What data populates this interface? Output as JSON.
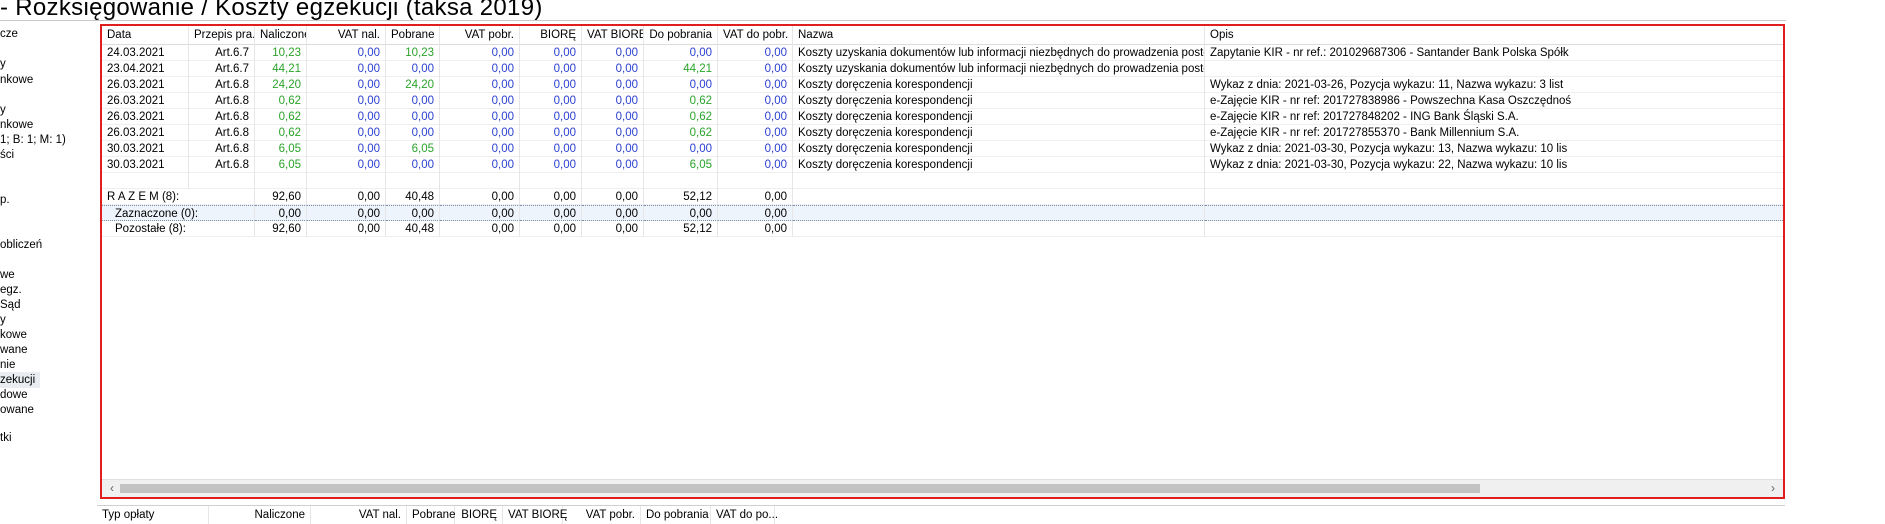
{
  "window": {
    "title": "- Rozksięgowanie / Koszty egzekucji (taksa 2019)"
  },
  "left_nav": {
    "items": [
      {
        "label": "cze"
      },
      {
        "label": ""
      },
      {
        "label": "y"
      },
      {
        "label": "nkowe"
      },
      {
        "label": ""
      },
      {
        "label": "y"
      },
      {
        "label": "nkowe"
      },
      {
        "label": "1; B: 1; M: 1)"
      },
      {
        "label": "ści"
      },
      {
        "label": ""
      },
      {
        "label": ""
      },
      {
        "label": "p."
      },
      {
        "label": ""
      },
      {
        "label": ""
      },
      {
        "label": "obliczeń"
      },
      {
        "label": ""
      },
      {
        "label": "we"
      },
      {
        "label": "egz."
      },
      {
        "label": "Sąd"
      },
      {
        "label": "y"
      },
      {
        "label": "kowe"
      },
      {
        "label": "wane"
      },
      {
        "label": "nie"
      },
      {
        "label": "zekucji"
      },
      {
        "label": "dowe"
      },
      {
        "label": "owane"
      },
      {
        "label": ""
      },
      {
        "label": "tki"
      }
    ]
  },
  "table": {
    "columns": [
      "Data",
      "Przepis pra...",
      "Naliczone",
      "VAT nal.",
      "Pobrane",
      "VAT pobr.",
      "BIORĘ",
      "VAT BIORĘ",
      "Do pobrania",
      "VAT do pobr.",
      "Nazwa",
      "Opis"
    ],
    "rows": [
      {
        "data": "24.03.2021",
        "przepis": "Art.6.7",
        "naliczone": "10,23",
        "vat_nal": "0,00",
        "pobrane": "10,23",
        "vat_pobr": "0,00",
        "biore": "0,00",
        "vat_biore": "0,00",
        "do_pobrania": "0,00",
        "vat_do_pobr": "0,00",
        "nazwa": "Koszty uzyskania dokumentów lub informacji niezbędnych do prowadzenia postępowania",
        "opis": "Zapytanie KIR - nr ref.: 201029687306 - Santander Bank Polska Spółk"
      },
      {
        "data": "23.04.2021",
        "przepis": "Art.6.7",
        "naliczone": "44,21",
        "vat_nal": "0,00",
        "pobrane": "0,00",
        "vat_pobr": "0,00",
        "biore": "0,00",
        "vat_biore": "0,00",
        "do_pobrania": "44,21",
        "vat_do_pobr": "0,00",
        "nazwa": "Koszty uzyskania dokumentów lub informacji niezbędnych do prowadzenia postępowania",
        "opis": ""
      },
      {
        "data": "26.03.2021",
        "przepis": "Art.6.8",
        "naliczone": "24,20",
        "vat_nal": "0,00",
        "pobrane": "24,20",
        "vat_pobr": "0,00",
        "biore": "0,00",
        "vat_biore": "0,00",
        "do_pobrania": "0,00",
        "vat_do_pobr": "0,00",
        "nazwa": "Koszty doręczenia korespondencji",
        "opis": "Wykaz z dnia: 2021-03-26, Pozycja wykazu: 11, Nazwa wykazu: 3 list"
      },
      {
        "data": "26.03.2021",
        "przepis": "Art.6.8",
        "naliczone": "0,62",
        "vat_nal": "0,00",
        "pobrane": "0,00",
        "vat_pobr": "0,00",
        "biore": "0,00",
        "vat_biore": "0,00",
        "do_pobrania": "0,62",
        "vat_do_pobr": "0,00",
        "nazwa": "Koszty doręczenia korespondencji",
        "opis": "e-Zajęcie KIR - nr ref: 201727838986 - Powszechna Kasa Oszczędnoś"
      },
      {
        "data": "26.03.2021",
        "przepis": "Art.6.8",
        "naliczone": "0,62",
        "vat_nal": "0,00",
        "pobrane": "0,00",
        "vat_pobr": "0,00",
        "biore": "0,00",
        "vat_biore": "0,00",
        "do_pobrania": "0,62",
        "vat_do_pobr": "0,00",
        "nazwa": "Koszty doręczenia korespondencji",
        "opis": "e-Zajęcie KIR - nr ref: 201727848202 - ING Bank Śląski S.A."
      },
      {
        "data": "26.03.2021",
        "przepis": "Art.6.8",
        "naliczone": "0,62",
        "vat_nal": "0,00",
        "pobrane": "0,00",
        "vat_pobr": "0,00",
        "biore": "0,00",
        "vat_biore": "0,00",
        "do_pobrania": "0,62",
        "vat_do_pobr": "0,00",
        "nazwa": "Koszty doręczenia korespondencji",
        "opis": "e-Zajęcie KIR - nr ref: 201727855370 - Bank Millennium S.A."
      },
      {
        "data": "30.03.2021",
        "przepis": "Art.6.8",
        "naliczone": "6,05",
        "vat_nal": "0,00",
        "pobrane": "6,05",
        "vat_pobr": "0,00",
        "biore": "0,00",
        "vat_biore": "0,00",
        "do_pobrania": "0,00",
        "vat_do_pobr": "0,00",
        "nazwa": "Koszty doręczenia korespondencji",
        "opis": "Wykaz z dnia: 2021-03-30, Pozycja wykazu: 13, Nazwa wykazu: 10 lis"
      },
      {
        "data": "30.03.2021",
        "przepis": "Art.6.8",
        "naliczone": "6,05",
        "vat_nal": "0,00",
        "pobrane": "0,00",
        "vat_pobr": "0,00",
        "biore": "0,00",
        "vat_biore": "0,00",
        "do_pobrania": "6,05",
        "vat_do_pobr": "0,00",
        "nazwa": "Koszty doręczenia korespondencji",
        "opis": "Wykaz z dnia: 2021-03-30, Pozycja wykazu: 22, Nazwa wykazu: 10 lis"
      }
    ],
    "summary": [
      {
        "label": "R A Z E M (8):",
        "naliczone": "92,60",
        "vat_nal": "0,00",
        "pobrane": "40,48",
        "vat_pobr": "0,00",
        "biore": "0,00",
        "vat_biore": "0,00",
        "do_pobrania": "52,12",
        "vat_do_pobr": "0,00"
      },
      {
        "label": "Zaznaczone (0):",
        "naliczone": "0,00",
        "vat_nal": "0,00",
        "pobrane": "0,00",
        "vat_pobr": "0,00",
        "biore": "0,00",
        "vat_biore": "0,00",
        "do_pobrania": "0,00",
        "vat_do_pobr": "0,00"
      },
      {
        "label": "Pozostałe (8):",
        "naliczone": "92,60",
        "vat_nal": "0,00",
        "pobrane": "40,48",
        "vat_pobr": "0,00",
        "biore": "0,00",
        "vat_biore": "0,00",
        "do_pobrania": "52,12",
        "vat_do_pobr": "0,00"
      }
    ]
  },
  "bottom_table": {
    "columns": [
      "Typ opłaty",
      "Naliczone",
      "VAT nal.",
      "Pobrane",
      "BIORĘ",
      "VAT BIORĘ",
      "VAT pobr.",
      "Do pobrania",
      "VAT do po..."
    ]
  },
  "colors": {
    "accent_border": "#e01e1e",
    "green_value": "#2ba32b",
    "blue_value": "#2b3fd1"
  }
}
